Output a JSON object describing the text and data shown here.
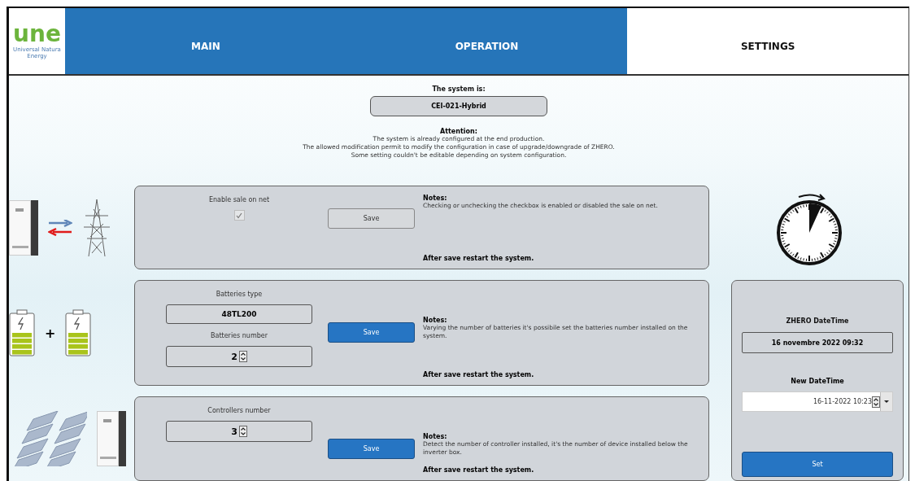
{
  "logo": {
    "text": "une",
    "subtitle": "Universal Natura Energy"
  },
  "tabs": [
    {
      "label": "MAIN",
      "selected": false
    },
    {
      "label": "OPERATION",
      "selected": false
    },
    {
      "label": "SETTINGS",
      "selected": true
    }
  ],
  "system": {
    "label": "The system is:",
    "value": "CEI-021-Hybrid"
  },
  "attention": {
    "title": "Attention:",
    "lines": [
      "The system is already configured at the end production.",
      "The allowed modification permit to modify the configuration in case of upgrade/downgrade of ZHERO.",
      "Some setting couldn't be editable depending on system configuration."
    ]
  },
  "panels": [
    {
      "kind": "grid",
      "fields": [
        {
          "kind": "checkbox",
          "label": "Enable sale on net",
          "checked": true
        }
      ],
      "save": {
        "label": "Save",
        "disabled": true
      },
      "notes_title": "Notes:",
      "notes": "Checking or unchecking the checkbox is enabled or disabled the sale on net.",
      "footer": "After save restart the system."
    },
    {
      "kind": "batteries",
      "joiner": "+",
      "fields": [
        {
          "kind": "readonly",
          "label": "Batteries type",
          "value": "48TL200"
        },
        {
          "kind": "spinner",
          "label": "Batteries number",
          "value": "2"
        }
      ],
      "save": {
        "label": "Save",
        "disabled": false
      },
      "notes_title": "Notes:",
      "notes": "Varying the number of batteries it's possibile set the batteries number installed on the system.",
      "footer": "After save restart the system."
    },
    {
      "kind": "solar",
      "fields": [
        {
          "kind": "spinner",
          "label": "Controllers number",
          "value": "3"
        }
      ],
      "save": {
        "label": "Save",
        "disabled": false
      },
      "notes_title": "Notes:",
      "notes": "Detect the number of controller installed, it's the number of device installed below the inverter box.",
      "footer": "After save restart the system."
    }
  ],
  "datetime": {
    "title": "ZHERO DateTime",
    "current": "16 novembre 2022 09:32",
    "new_label": "New DateTime",
    "new_value": "16-11-2022 10:23",
    "button": "Set"
  }
}
